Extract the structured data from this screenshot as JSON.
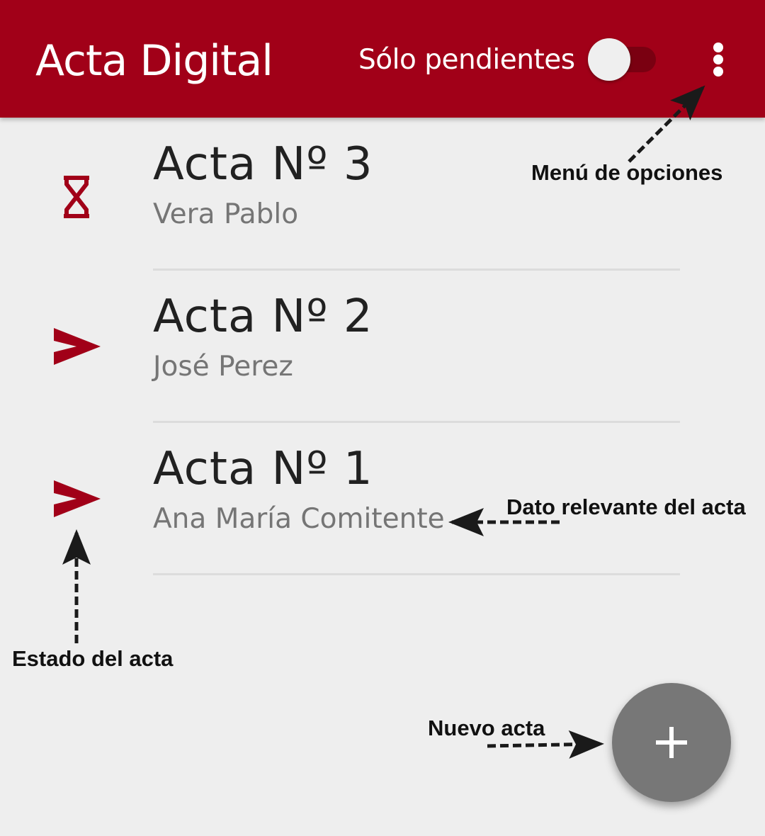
{
  "app_bar": {
    "title": "Acta Digital",
    "filter_label": "Sólo pendientes",
    "filter_on": false,
    "menu_icon": "more-vert-icon",
    "color": "#a10018"
  },
  "actas": [
    {
      "title": "Acta Nº 3",
      "subtitle": "Vera Pablo",
      "status_icon": "hourglass-icon",
      "status": "pendiente"
    },
    {
      "title": "Acta Nº 2",
      "subtitle": "José Perez",
      "status_icon": "send-icon",
      "status": "enviada"
    },
    {
      "title": "Acta Nº 1",
      "subtitle": "Ana María Comitente",
      "status_icon": "send-icon",
      "status": "enviada"
    }
  ],
  "fab": {
    "icon": "plus-icon",
    "color": "#777777"
  },
  "annotations": {
    "menu": "Menú de opciones",
    "dato": "Dato relevante del acta",
    "estado": "Estado del acta",
    "nuevo": "Nuevo acta"
  }
}
